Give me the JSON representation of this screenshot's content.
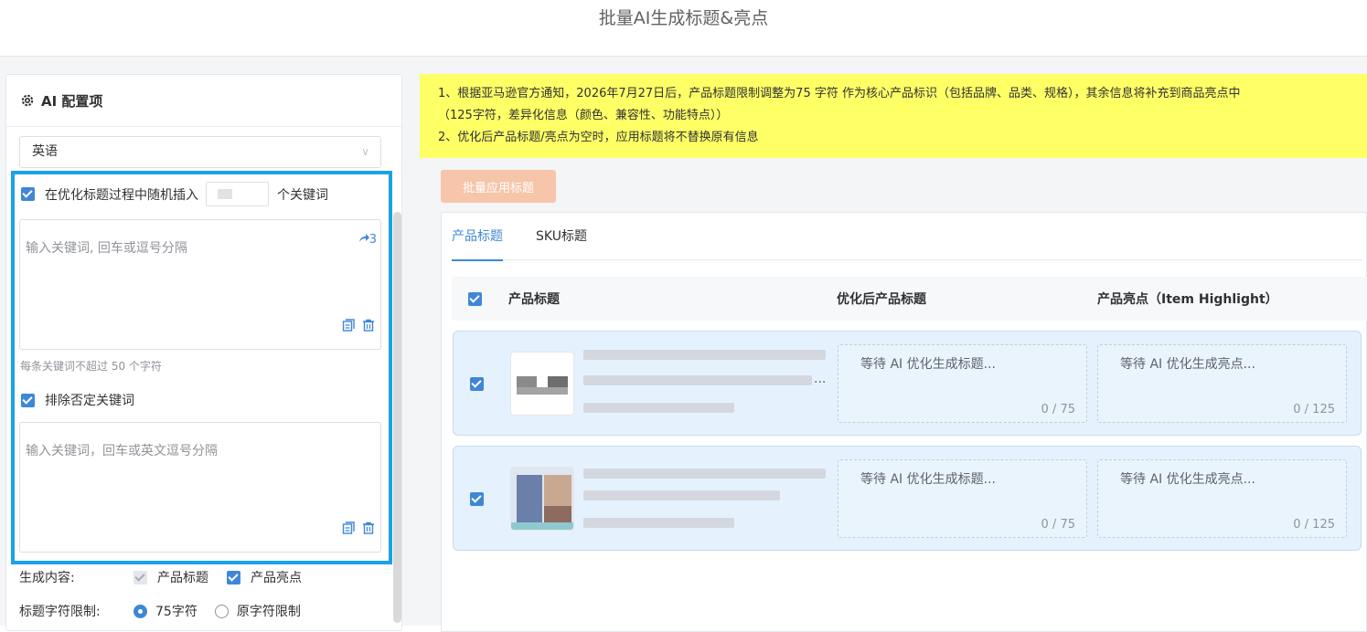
{
  "header": {
    "title": "批量AI生成标题&亮点"
  },
  "config": {
    "heading": "AI 配置项",
    "language": "英语",
    "insert_prefix": "在优化标题过程中随机插入",
    "insert_suffix": "个关键词",
    "keyword_placeholder": "输入关键词, 回车或逗号分隔",
    "keyword_count": "3",
    "keyword_hint": "每条关键词不超过 50 个字符",
    "exclude_label": "排除否定关键词",
    "exclude_placeholder": "输入关键词，回车或英文逗号分隔",
    "generate_label": "生成内容:",
    "gen_title": "产品标题",
    "gen_highlight": "产品亮点",
    "limit_label": "标题字符限制:",
    "limit_75": "75字符",
    "limit_orig": "原字符限制"
  },
  "notice": {
    "line1": "1、根据亚马逊官方通知，2026年7月27日后，产品标题限制调整为75 字符 作为核心产品标识（包括品牌、品类、规格），其余信息将补充到商品亮点中",
    "line2": "（125字符，差异化信息（颜色、兼容性、功能特点））",
    "line3": "2、优化后产品标题/亮点为空时，应用标题将不替换原有信息"
  },
  "toolbar": {
    "apply_label": "批量应用标题"
  },
  "tabs": [
    {
      "label": "产品标题"
    },
    {
      "label": "SKU标题"
    }
  ],
  "table": {
    "headers": {
      "title": "产品标题",
      "optimized": "优化后产品标题",
      "highlight": "产品亮点（Item Highlight）"
    },
    "rows": [
      {
        "ellipsis": "...",
        "title_waiting": "等待 AI 优化生成标题...",
        "title_count": "0 / 75",
        "hl_waiting": "等待 AI 优化生成亮点...",
        "hl_count": "0 / 125"
      },
      {
        "ellipsis": "",
        "title_waiting": "等待 AI 优化生成标题...",
        "title_count": "0 / 75",
        "hl_waiting": "等待 AI 优化生成亮点...",
        "hl_count": "0 / 125"
      }
    ]
  },
  "colors": {
    "accent": "#3f87d6",
    "highlight_border": "#1aa3ea",
    "notice_bg": "#ffff66",
    "apply_button": "#f7c5a9"
  }
}
